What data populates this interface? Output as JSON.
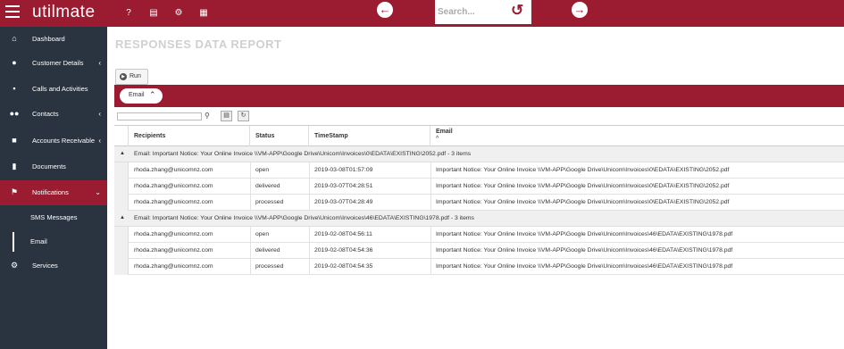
{
  "app": {
    "logo": "utilmate",
    "search_placeholder": "Search...",
    "top_icons": [
      "help-icon",
      "document-icon",
      "settings-icon",
      "calendar-icon"
    ],
    "back_icon": "arrow-left-circle-icon",
    "forward_icon": "arrow-right-circle-icon",
    "brand_color": "#9b1b30",
    "sidebar_color": "#2a3440"
  },
  "sidebar": {
    "items": [
      {
        "label": "Dashboard",
        "icon": "home-icon"
      },
      {
        "label": "Customer Details",
        "icon": "user-icon",
        "chevron": "‹"
      },
      {
        "label": "Calls and Activities",
        "icon": "calendar-icon"
      },
      {
        "label": "Contacts",
        "icon": "users-icon",
        "chevron": "‹"
      },
      {
        "label": "Accounts Receivable",
        "icon": "lock-icon",
        "chevron": "‹"
      },
      {
        "label": "Documents",
        "icon": "file-icon"
      },
      {
        "label": "Notifications",
        "icon": "flag-icon",
        "chevron": "⌄",
        "active": true
      }
    ],
    "sub_items": [
      {
        "label": "SMS Messages"
      },
      {
        "label": "Email",
        "selected": true
      }
    ],
    "services": {
      "label": "Services",
      "icon": "cogs-icon"
    }
  },
  "page": {
    "title": "RESPONSES DATA REPORT",
    "run_label": "Run",
    "filter_chip": "Email"
  },
  "grid": {
    "columns": [
      "Recipients",
      "Status",
      "TimeStamp",
      "Email"
    ],
    "sort_indicator": "^",
    "groups": [
      {
        "label": "Email: Important Notice: Your Online Invoice \\\\VM-APP\\Google Drive\\Unicom\\Invoices\\0\\EDATA\\EXISTING\\2052.pdf - 3 items",
        "rows": [
          {
            "recipient": "rhoda.zhang@unicomnz.com",
            "status": "open",
            "timestamp": "2019-03-08T01:57:09",
            "email": "Important Notice: Your Online Invoice \\\\VM-APP\\Google Drive\\Unicom\\Invoices\\0\\EDATA\\EXISTING\\2052.pdf"
          },
          {
            "recipient": "rhoda.zhang@unicomnz.com",
            "status": "delivered",
            "timestamp": "2019-03-07T04:28:51",
            "email": "Important Notice: Your Online Invoice \\\\VM-APP\\Google Drive\\Unicom\\Invoices\\0\\EDATA\\EXISTING\\2052.pdf"
          },
          {
            "recipient": "rhoda.zhang@unicomnz.com",
            "status": "processed",
            "timestamp": "2019-03-07T04:28:49",
            "email": "Important Notice: Your Online Invoice \\\\VM-APP\\Google Drive\\Unicom\\Invoices\\0\\EDATA\\EXISTING\\2052.pdf"
          }
        ]
      },
      {
        "label": "Email: Important Notice: Your Online Invoice \\\\VM-APP\\Google Drive\\Unicom\\Invoices\\46\\EDATA\\EXISTING\\1978.pdf - 3 items",
        "rows": [
          {
            "recipient": "rhoda.zhang@unicomnz.com",
            "status": "open",
            "timestamp": "2019-02-08T04:56:11",
            "email": "Important Notice: Your Online Invoice \\\\VM-APP\\Google Drive\\Unicom\\Invoices\\46\\EDATA\\EXISTING\\1978.pdf"
          },
          {
            "recipient": "rhoda.zhang@unicomnz.com",
            "status": "delivered",
            "timestamp": "2019-02-08T04:54:36",
            "email": "Important Notice: Your Online Invoice \\\\VM-APP\\Google Drive\\Unicom\\Invoices\\46\\EDATA\\EXISTING\\1978.pdf"
          },
          {
            "recipient": "rhoda.zhang@unicomnz.com",
            "status": "processed",
            "timestamp": "2019-02-08T04:54:35",
            "email": "Important Notice: Your Online Invoice \\\\VM-APP\\Google Drive\\Unicom\\Invoices\\46\\EDATA\\EXISTING\\1978.pdf"
          }
        ]
      }
    ]
  }
}
